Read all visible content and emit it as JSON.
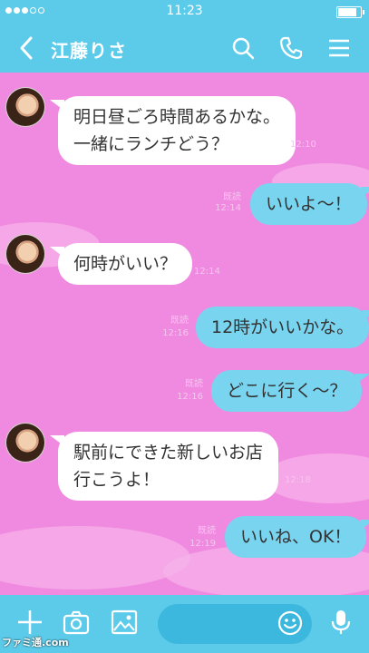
{
  "status_bar": {
    "time": "11:23"
  },
  "header": {
    "title": "江藤りさ"
  },
  "messages": [
    {
      "line1": "明日昼ごろ時間あるかな。",
      "line2": "一緒にランチどう？",
      "time": "12:10"
    },
    {
      "text": "いいよ〜！",
      "read": "既読",
      "time": "12:14"
    },
    {
      "text": "何時がいい？",
      "time": "12:14"
    },
    {
      "text": "12時がいいかな。",
      "read": "既読",
      "time": "12:16"
    },
    {
      "text": "どこに行く〜？",
      "read": "既読",
      "time": "12:16"
    },
    {
      "line1": "駅前にできた新しいお店",
      "line2": "行こうよ！",
      "time": "12:18"
    },
    {
      "text": "いいね、OK！",
      "read": "既読",
      "time": "12:19"
    }
  ],
  "watermark": "ファミ通.com",
  "colors": {
    "accent": "#5ccbea",
    "background": "#f08ae0",
    "outgoing_bubble": "#79d4ef",
    "incoming_bubble": "#ffffff"
  }
}
